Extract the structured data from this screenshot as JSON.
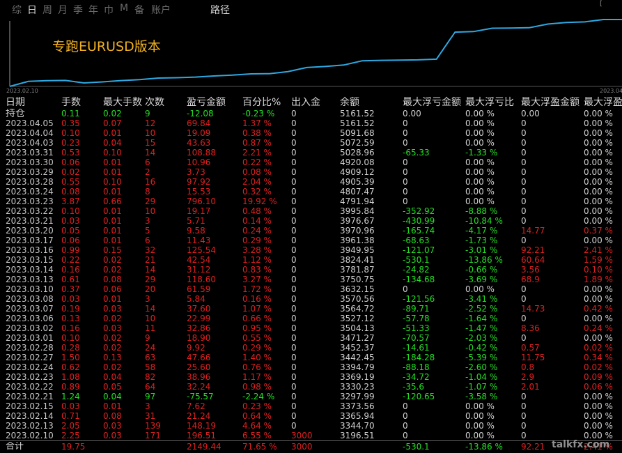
{
  "tabs": [
    "综",
    "日",
    "周",
    "月",
    "季",
    "年",
    "巾",
    "M",
    "备",
    "账户"
  ],
  "route_label": "路径",
  "corner_mark": "[",
  "chart": {
    "title": "专跑EURUSD版本",
    "x_start": "2023.02.10",
    "x_end": "2023.04",
    "line_color": "#2ea8e0"
  },
  "chart_data": {
    "type": "line",
    "title": "专跑EURUSD版本",
    "x": [
      "2023.02.10",
      "2023.02.13",
      "2023.02.14",
      "2023.02.15",
      "2023.02.21",
      "2023.02.22",
      "2023.02.23",
      "2023.02.24",
      "2023.02.27",
      "2023.02.28",
      "2023.03.01",
      "2023.03.02",
      "2023.03.03",
      "2023.03.06",
      "2023.03.07",
      "2023.03.08",
      "2023.03.10",
      "2023.03.13",
      "2023.03.14",
      "2023.03.15",
      "2023.03.16",
      "2023.03.17",
      "2023.03.20",
      "2023.03.21",
      "2023.03.22",
      "2023.03.23",
      "2023.03.24",
      "2023.03.28",
      "2023.03.29",
      "2023.03.30",
      "2023.03.31",
      "2023.04.03",
      "2023.04.04",
      "2023.04.05"
    ],
    "values": [
      3196.51,
      3344.7,
      3365.94,
      3373.56,
      3297.99,
      3330.23,
      3369.19,
      3394.79,
      3442.45,
      3452.37,
      3471.27,
      3504.13,
      3527.12,
      3564.72,
      3570.56,
      3632.15,
      3750.75,
      3781.87,
      3824.41,
      3949.95,
      3961.38,
      3970.96,
      3976.67,
      3995.84,
      4791.94,
      4807.47,
      4905.39,
      4909.12,
      4920.08,
      5028.96,
      5072.59,
      5091.68,
      5161.52,
      5161.52
    ]
  },
  "headers": [
    "日期",
    "手数",
    "最大手数",
    "次数",
    "盈亏金额",
    "百分比%",
    "出入金",
    "余额",
    "最大浮亏金额",
    "最大浮亏比",
    "最大浮盈金额",
    "最大浮盈"
  ],
  "colors": {
    "red": "#e02020",
    "green": "#22e022",
    "white": "#d0d0d0",
    "line": "#2ea8e0"
  },
  "rows": [
    {
      "date": "持仓",
      "lots": "0.11",
      "maxlots": "0.02",
      "count": "9",
      "pnl": "-12.08",
      "pct": "-0.23 %",
      "inout": "0",
      "balance": "5161.52",
      "maxloss": "0.00",
      "maxlosspct": "0.00 %",
      "maxprofit": "0.00",
      "maxprofitpct": "0.00 %",
      "sign": "neg",
      "lossNeg": false,
      "profitPos": false
    },
    {
      "date": "2023.04.05",
      "lots": "0.35",
      "maxlots": "0.07",
      "count": "12",
      "pnl": "69.84",
      "pct": "1.37 %",
      "inout": "0",
      "balance": "5161.52",
      "maxloss": "0",
      "maxlosspct": "0.00 %",
      "maxprofit": "0",
      "maxprofitpct": "0.00 %",
      "sign": "pos",
      "lossNeg": false,
      "profitPos": false
    },
    {
      "date": "2023.04.04",
      "lots": "0.10",
      "maxlots": "0.01",
      "count": "10",
      "pnl": "19.09",
      "pct": "0.38 %",
      "inout": "0",
      "balance": "5091.68",
      "maxloss": "0",
      "maxlosspct": "0.00 %",
      "maxprofit": "0",
      "maxprofitpct": "0.00 %",
      "sign": "pos",
      "lossNeg": false,
      "profitPos": false
    },
    {
      "date": "2023.04.03",
      "lots": "0.23",
      "maxlots": "0.04",
      "count": "15",
      "pnl": "43.63",
      "pct": "0.87 %",
      "inout": "0",
      "balance": "5072.59",
      "maxloss": "0",
      "maxlosspct": "0.00 %",
      "maxprofit": "0",
      "maxprofitpct": "0.00 %",
      "sign": "pos",
      "lossNeg": false,
      "profitPos": false
    },
    {
      "date": "2023.03.31",
      "lots": "0.53",
      "maxlots": "0.10",
      "count": "14",
      "pnl": "108.88",
      "pct": "2.21 %",
      "inout": "0",
      "balance": "5028.96",
      "maxloss": "-65.33",
      "maxlosspct": "-1.33 %",
      "maxprofit": "0",
      "maxprofitpct": "0.00 %",
      "sign": "pos",
      "lossNeg": true,
      "profitPos": false
    },
    {
      "date": "2023.03.30",
      "lots": "0.06",
      "maxlots": "0.01",
      "count": "6",
      "pnl": "10.96",
      "pct": "0.22 %",
      "inout": "0",
      "balance": "4920.08",
      "maxloss": "0",
      "maxlosspct": "0.00 %",
      "maxprofit": "0",
      "maxprofitpct": "0.00 %",
      "sign": "pos",
      "lossNeg": false,
      "profitPos": false
    },
    {
      "date": "2023.03.29",
      "lots": "0.02",
      "maxlots": "0.01",
      "count": "2",
      "pnl": "3.73",
      "pct": "0.08 %",
      "inout": "0",
      "balance": "4909.12",
      "maxloss": "0",
      "maxlosspct": "0.00 %",
      "maxprofit": "0",
      "maxprofitpct": "0.00 %",
      "sign": "pos",
      "lossNeg": false,
      "profitPos": false
    },
    {
      "date": "2023.03.28",
      "lots": "0.55",
      "maxlots": "0.10",
      "count": "16",
      "pnl": "97.92",
      "pct": "2.04 %",
      "inout": "0",
      "balance": "4905.39",
      "maxloss": "0",
      "maxlosspct": "0.00 %",
      "maxprofit": "0",
      "maxprofitpct": "0.00 %",
      "sign": "pos",
      "lossNeg": false,
      "profitPos": false
    },
    {
      "date": "2023.03.24",
      "lots": "0.08",
      "maxlots": "0.01",
      "count": "8",
      "pnl": "15.53",
      "pct": "0.32 %",
      "inout": "0",
      "balance": "4807.47",
      "maxloss": "0",
      "maxlosspct": "0.00 %",
      "maxprofit": "0",
      "maxprofitpct": "0.00 %",
      "sign": "pos",
      "lossNeg": false,
      "profitPos": false
    },
    {
      "date": "2023.03.23",
      "lots": "3.87",
      "maxlots": "0.66",
      "count": "29",
      "pnl": "796.10",
      "pct": "19.92 %",
      "inout": "0",
      "balance": "4791.94",
      "maxloss": "0",
      "maxlosspct": "0.00 %",
      "maxprofit": "0",
      "maxprofitpct": "0.00 %",
      "sign": "pos",
      "lossNeg": false,
      "profitPos": false
    },
    {
      "date": "2023.03.22",
      "lots": "0.10",
      "maxlots": "0.01",
      "count": "10",
      "pnl": "19.17",
      "pct": "0.48 %",
      "inout": "0",
      "balance": "3995.84",
      "maxloss": "-352.92",
      "maxlosspct": "-8.88 %",
      "maxprofit": "0",
      "maxprofitpct": "0.00 %",
      "sign": "pos",
      "lossNeg": true,
      "profitPos": false
    },
    {
      "date": "2023.03.21",
      "lots": "0.03",
      "maxlots": "0.01",
      "count": "3",
      "pnl": "5.71",
      "pct": "0.14 %",
      "inout": "0",
      "balance": "3976.67",
      "maxloss": "-430.99",
      "maxlosspct": "-10.84 %",
      "maxprofit": "0",
      "maxprofitpct": "0.00 %",
      "sign": "pos",
      "lossNeg": true,
      "profitPos": false
    },
    {
      "date": "2023.03.20",
      "lots": "0.05",
      "maxlots": "0.01",
      "count": "5",
      "pnl": "9.58",
      "pct": "0.24 %",
      "inout": "0",
      "balance": "3970.96",
      "maxloss": "-165.74",
      "maxlosspct": "-4.17 %",
      "maxprofit": "14.77",
      "maxprofitpct": "0.37 %",
      "sign": "pos",
      "lossNeg": true,
      "profitPos": true
    },
    {
      "date": "2023.03.17",
      "lots": "0.06",
      "maxlots": "0.01",
      "count": "6",
      "pnl": "11.43",
      "pct": "0.29 %",
      "inout": "0",
      "balance": "3961.38",
      "maxloss": "-68.63",
      "maxlosspct": "-1.73 %",
      "maxprofit": "0",
      "maxprofitpct": "0.00 %",
      "sign": "pos",
      "lossNeg": true,
      "profitPos": false
    },
    {
      "date": "2023.03.16",
      "lots": "0.99",
      "maxlots": "0.15",
      "count": "32",
      "pnl": "125.54",
      "pct": "3.28 %",
      "inout": "0",
      "balance": "3949.95",
      "maxloss": "-121.07",
      "maxlosspct": "-3.01 %",
      "maxprofit": "92.21",
      "maxprofitpct": "2.41 %",
      "sign": "pos",
      "lossNeg": true,
      "profitPos": true
    },
    {
      "date": "2023.03.15",
      "lots": "0.22",
      "maxlots": "0.02",
      "count": "21",
      "pnl": "42.54",
      "pct": "1.12 %",
      "inout": "0",
      "balance": "3824.41",
      "maxloss": "-530.1",
      "maxlosspct": "-13.86 %",
      "maxprofit": "60.64",
      "maxprofitpct": "1.59 %",
      "sign": "pos",
      "lossNeg": true,
      "profitPos": true
    },
    {
      "date": "2023.03.14",
      "lots": "0.16",
      "maxlots": "0.02",
      "count": "14",
      "pnl": "31.12",
      "pct": "0.83 %",
      "inout": "0",
      "balance": "3781.87",
      "maxloss": "-24.82",
      "maxlosspct": "-0.66 %",
      "maxprofit": "3.56",
      "maxprofitpct": "0.10 %",
      "sign": "pos",
      "lossNeg": true,
      "profitPos": true
    },
    {
      "date": "2023.03.13",
      "lots": "0.61",
      "maxlots": "0.08",
      "count": "29",
      "pnl": "118.60",
      "pct": "3.27 %",
      "inout": "0",
      "balance": "3750.75",
      "maxloss": "-134.68",
      "maxlosspct": "-3.69 %",
      "maxprofit": "68.9",
      "maxprofitpct": "1.89 %",
      "sign": "pos",
      "lossNeg": true,
      "profitPos": true
    },
    {
      "date": "2023.03.10",
      "lots": "0.37",
      "maxlots": "0.06",
      "count": "20",
      "pnl": "61.59",
      "pct": "1.72 %",
      "inout": "0",
      "balance": "3632.15",
      "maxloss": "0",
      "maxlosspct": "0.00 %",
      "maxprofit": "0",
      "maxprofitpct": "0.00 %",
      "sign": "pos",
      "lossNeg": false,
      "profitPos": false
    },
    {
      "date": "2023.03.08",
      "lots": "0.03",
      "maxlots": "0.01",
      "count": "3",
      "pnl": "5.84",
      "pct": "0.16 %",
      "inout": "0",
      "balance": "3570.56",
      "maxloss": "-121.56",
      "maxlosspct": "-3.41 %",
      "maxprofit": "0",
      "maxprofitpct": "0.00 %",
      "sign": "pos",
      "lossNeg": true,
      "profitPos": false
    },
    {
      "date": "2023.03.07",
      "lots": "0.19",
      "maxlots": "0.03",
      "count": "14",
      "pnl": "37.60",
      "pct": "1.07 %",
      "inout": "0",
      "balance": "3564.72",
      "maxloss": "-89.71",
      "maxlosspct": "-2.52 %",
      "maxprofit": "14.73",
      "maxprofitpct": "0.42 %",
      "sign": "pos",
      "lossNeg": true,
      "profitPos": true
    },
    {
      "date": "2023.03.06",
      "lots": "0.13",
      "maxlots": "0.02",
      "count": "10",
      "pnl": "22.99",
      "pct": "0.66 %",
      "inout": "0",
      "balance": "3527.12",
      "maxloss": "-57.78",
      "maxlosspct": "-1.64 %",
      "maxprofit": "0",
      "maxprofitpct": "0.00 %",
      "sign": "pos",
      "lossNeg": true,
      "profitPos": false
    },
    {
      "date": "2023.03.02",
      "lots": "0.16",
      "maxlots": "0.03",
      "count": "11",
      "pnl": "32.86",
      "pct": "0.95 %",
      "inout": "0",
      "balance": "3504.13",
      "maxloss": "-51.33",
      "maxlosspct": "-1.47 %",
      "maxprofit": "8.36",
      "maxprofitpct": "0.24 %",
      "sign": "pos",
      "lossNeg": true,
      "profitPos": true
    },
    {
      "date": "2023.03.01",
      "lots": "0.10",
      "maxlots": "0.02",
      "count": "9",
      "pnl": "18.90",
      "pct": "0.55 %",
      "inout": "0",
      "balance": "3471.27",
      "maxloss": "-70.57",
      "maxlosspct": "-2.03 %",
      "maxprofit": "0",
      "maxprofitpct": "0.00 %",
      "sign": "pos",
      "lossNeg": true,
      "profitPos": false
    },
    {
      "date": "2023.02.28",
      "lots": "0.28",
      "maxlots": "0.02",
      "count": "24",
      "pnl": "9.92",
      "pct": "0.29 %",
      "inout": "0",
      "balance": "3452.37",
      "maxloss": "-14.61",
      "maxlosspct": "-0.42 %",
      "maxprofit": "0.57",
      "maxprofitpct": "0.02 %",
      "sign": "pos",
      "lossNeg": true,
      "profitPos": true
    },
    {
      "date": "2023.02.27",
      "lots": "1.50",
      "maxlots": "0.13",
      "count": "63",
      "pnl": "47.66",
      "pct": "1.40 %",
      "inout": "0",
      "balance": "3442.45",
      "maxloss": "-184.28",
      "maxlosspct": "-5.39 %",
      "maxprofit": "11.75",
      "maxprofitpct": "0.34 %",
      "sign": "pos",
      "lossNeg": true,
      "profitPos": true
    },
    {
      "date": "2023.02.24",
      "lots": "0.62",
      "maxlots": "0.02",
      "count": "58",
      "pnl": "25.60",
      "pct": "0.76 %",
      "inout": "0",
      "balance": "3394.79",
      "maxloss": "-88.18",
      "maxlosspct": "-2.60 %",
      "maxprofit": "0.8",
      "maxprofitpct": "0.02 %",
      "sign": "pos",
      "lossNeg": true,
      "profitPos": true
    },
    {
      "date": "2023.02.23",
      "lots": "1.08",
      "maxlots": "0.04",
      "count": "82",
      "pnl": "38.96",
      "pct": "1.17 %",
      "inout": "0",
      "balance": "3369.19",
      "maxloss": "-34.72",
      "maxlosspct": "-1.04 %",
      "maxprofit": "2.9",
      "maxprofitpct": "0.09 %",
      "sign": "pos",
      "lossNeg": true,
      "profitPos": true
    },
    {
      "date": "2023.02.22",
      "lots": "0.89",
      "maxlots": "0.05",
      "count": "64",
      "pnl": "32.24",
      "pct": "0.98 %",
      "inout": "0",
      "balance": "3330.23",
      "maxloss": "-35.6",
      "maxlosspct": "-1.07 %",
      "maxprofit": "2.01",
      "maxprofitpct": "0.06 %",
      "sign": "pos",
      "lossNeg": true,
      "profitPos": true
    },
    {
      "date": "2023.02.21",
      "lots": "1.24",
      "maxlots": "0.04",
      "count": "97",
      "pnl": "-75.57",
      "pct": "-2.24 %",
      "inout": "0",
      "balance": "3297.99",
      "maxloss": "-120.65",
      "maxlosspct": "-3.58 %",
      "maxprofit": "0",
      "maxprofitpct": "0.00 %",
      "sign": "neg",
      "lossNeg": true,
      "profitPos": false
    },
    {
      "date": "2023.02.15",
      "lots": "0.03",
      "maxlots": "0.01",
      "count": "3",
      "pnl": "7.62",
      "pct": "0.23 %",
      "inout": "0",
      "balance": "3373.56",
      "maxloss": "0",
      "maxlosspct": "0.00 %",
      "maxprofit": "0",
      "maxprofitpct": "0.00 %",
      "sign": "pos",
      "lossNeg": false,
      "profitPos": false
    },
    {
      "date": "2023.02.14",
      "lots": "0.71",
      "maxlots": "0.08",
      "count": "31",
      "pnl": "21.24",
      "pct": "0.64 %",
      "inout": "0",
      "balance": "3365.94",
      "maxloss": "0",
      "maxlosspct": "0.00 %",
      "maxprofit": "0",
      "maxprofitpct": "0.00 %",
      "sign": "pos",
      "lossNeg": false,
      "profitPos": false
    },
    {
      "date": "2023.02.13",
      "lots": "2.05",
      "maxlots": "0.03",
      "count": "139",
      "pnl": "148.19",
      "pct": "4.64 %",
      "inout": "0",
      "balance": "3344.70",
      "maxloss": "0",
      "maxlosspct": "0.00 %",
      "maxprofit": "0",
      "maxprofitpct": "0.00 %",
      "sign": "pos",
      "lossNeg": false,
      "profitPos": false
    },
    {
      "date": "2023.02.10",
      "lots": "2.25",
      "maxlots": "0.03",
      "count": "171",
      "pnl": "196.51",
      "pct": "6.55 %",
      "inout": "3000",
      "balance": "3196.51",
      "maxloss": "0",
      "maxlosspct": "0.00 %",
      "maxprofit": "0",
      "maxprofitpct": "0.00 %",
      "sign": "pos",
      "lossNeg": false,
      "profitPos": false
    }
  ],
  "total": {
    "label": "合计",
    "lots": "19.75",
    "pnl": "2149.44",
    "pct": "71.65 %",
    "inout": "3000",
    "maxloss": "-530.1",
    "maxlosspct": "-13.86 %",
    "maxprofit": "92.21",
    "maxprofitpct": "2.41 %"
  },
  "watermark": "talkfx.com"
}
